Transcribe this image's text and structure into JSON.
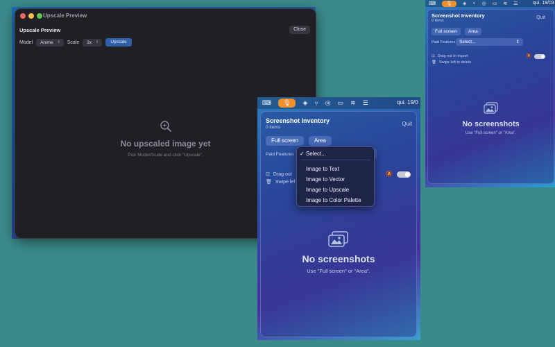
{
  "upscale_window": {
    "title": "Upscale Preview",
    "header": "Upscale Preview",
    "close_label": "Close",
    "model_label": "Model",
    "model_value": "Anime",
    "scale_label": "Scale",
    "scale_value": "2x",
    "upscale_label": "Upscale",
    "empty_title": "No upscaled image yet",
    "empty_hint": "Pick Model/Scale and click \"Upscale\"."
  },
  "menubar": {
    "date_big": "qui. 19/0",
    "date_small": "qui. 19/03"
  },
  "inventory_small": {
    "title": "Screenshot Inventory",
    "count": "0 items",
    "quit": "Quit",
    "full_screen": "Full screen",
    "area": "Area",
    "paid_features_label": "Paid Features",
    "select_value": "Select...",
    "hint_drag": "Drag out to export",
    "hint_swipe": "Swipe left to delete",
    "empty_title": "No screenshots",
    "empty_hint": "Use \"Full screen\" or \"Area\"."
  },
  "inventory_big": {
    "title": "Screenshot Inventory",
    "count": "0 items",
    "quit": "Quit",
    "full_screen": "Full screen",
    "area": "Area",
    "paid_features_label": "Paid Features",
    "hint_drag": "Drag out",
    "hint_swipe": "Swipe lef",
    "empty_title": "No screenshots",
    "empty_hint": "Use \"Full screen\" or \"Area\"."
  },
  "dropdown": {
    "selected": "Select...",
    "options": [
      "Image to Text",
      "Image to Vector",
      "Image to Upscale",
      "Image to Color Palette"
    ]
  }
}
